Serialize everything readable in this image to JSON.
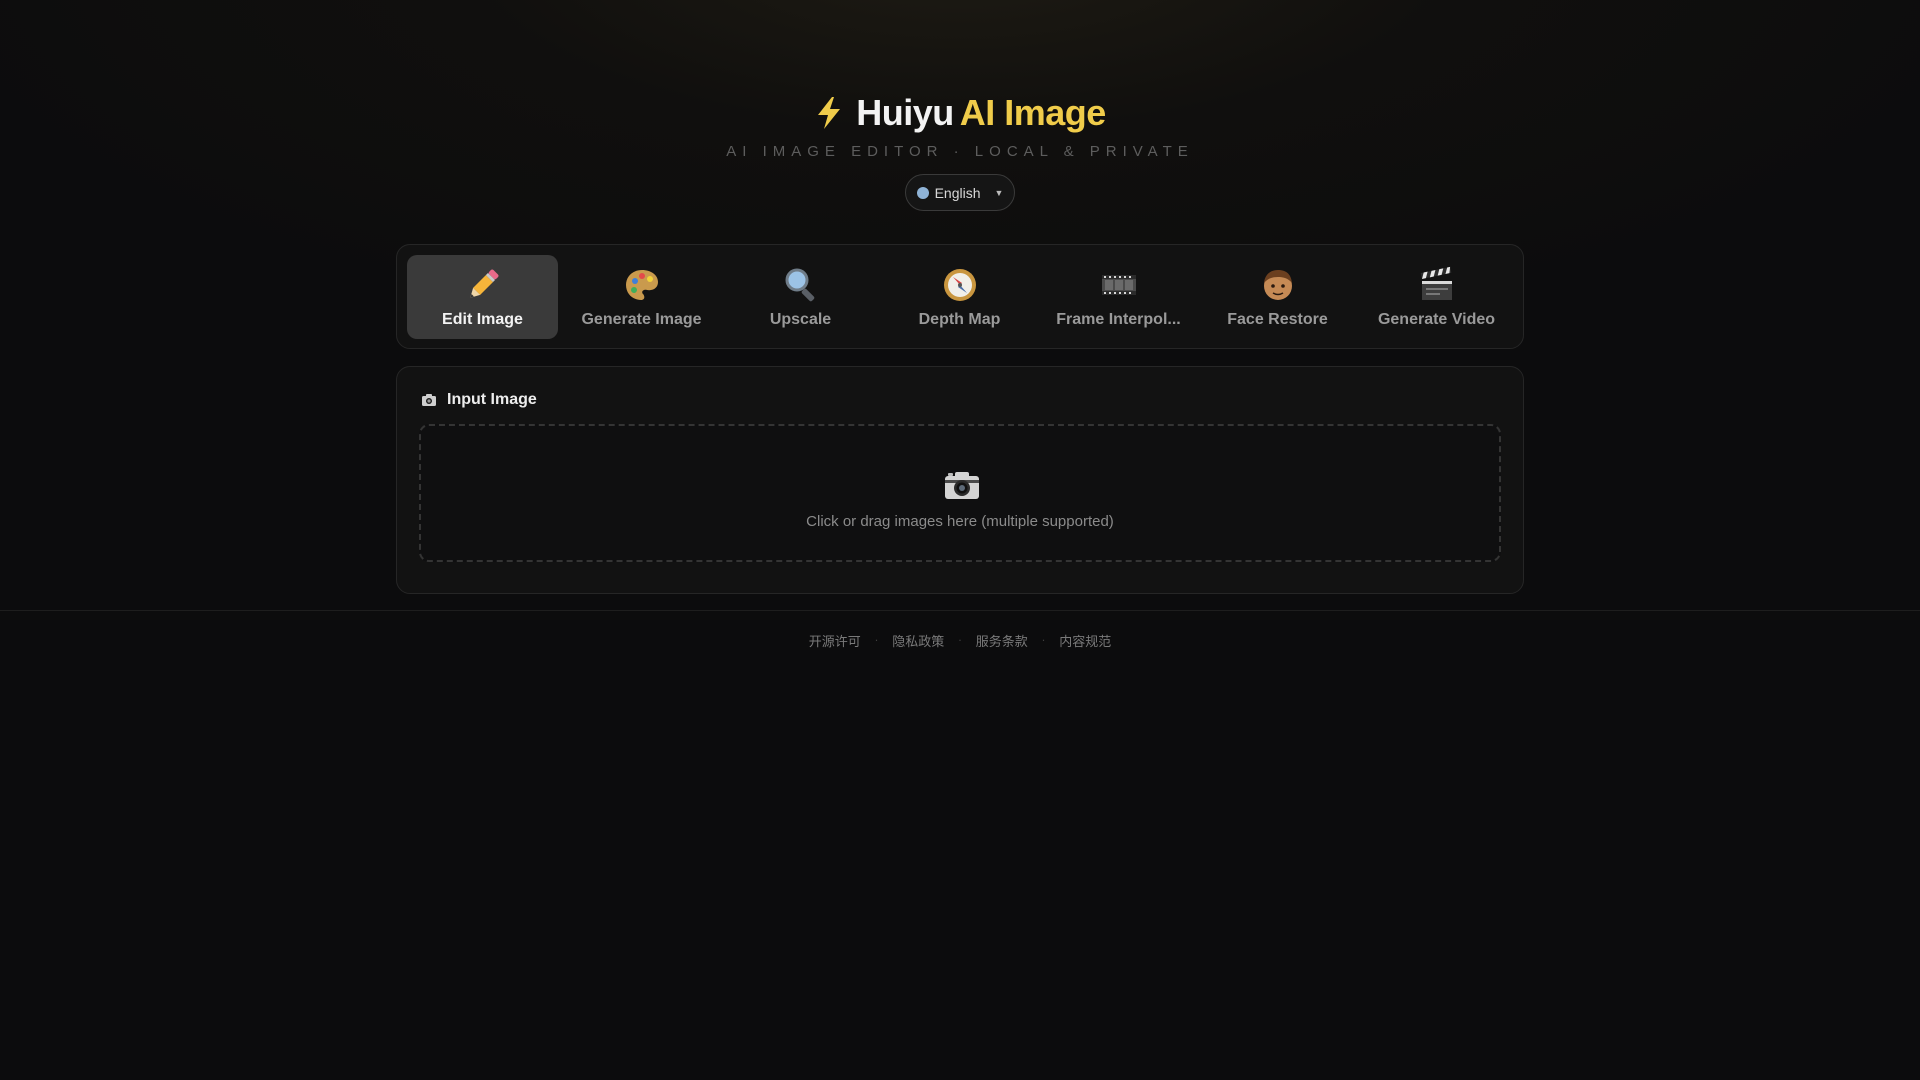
{
  "header": {
    "title_part1": "Huiyu",
    "title_part2": "AI Image",
    "subtitle": "AI IMAGE EDITOR · LOCAL & PRIVATE",
    "icon": "lightning-bolt-icon",
    "accent_color": "#f0cc4a"
  },
  "language": {
    "selected": "English",
    "icon": "globe-dot-icon"
  },
  "tabs": [
    {
      "label": "Edit Image",
      "icon": "pencil-icon",
      "active": true
    },
    {
      "label": "Generate Image",
      "icon": "palette-icon",
      "active": false
    },
    {
      "label": "Upscale",
      "icon": "magnifier-icon",
      "active": false
    },
    {
      "label": "Depth Map",
      "icon": "compass-icon",
      "active": false
    },
    {
      "label": "Frame Interpol...",
      "icon": "film-strip-icon",
      "active": false
    },
    {
      "label": "Face Restore",
      "icon": "face-icon",
      "active": false
    },
    {
      "label": "Generate Video",
      "icon": "clapperboard-icon",
      "active": false
    }
  ],
  "input_panel": {
    "title": "Input Image",
    "title_icon": "camera-icon",
    "dropzone_icon": "camera-icon",
    "dropzone_hint": "Click or drag images here (multiple supported)"
  },
  "footer": {
    "links": [
      "开源许可",
      "隐私政策",
      "服务条款",
      "内容规范"
    ],
    "separator": "·"
  }
}
